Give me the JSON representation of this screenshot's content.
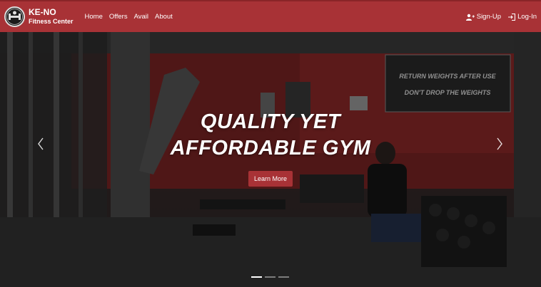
{
  "brand": {
    "title": "KE-NO",
    "subtitle": "Fitness Center"
  },
  "nav": {
    "links": [
      "Home",
      "Offers",
      "Avail",
      "About"
    ],
    "signup": "Sign-Up",
    "login": "Log-In"
  },
  "hero": {
    "headline_line1": "QUALITY YET",
    "headline_line2": "AFFORDABLE GYM",
    "button": "Learn More",
    "banner_line1": "RETURN WEIGHTS AFTER USE",
    "banner_line2": "DON'T DROP THE WEIGHTS",
    "slide_count": 3,
    "active_slide": 1
  },
  "colors": {
    "accent": "#a83236",
    "text": "#ffffff"
  }
}
